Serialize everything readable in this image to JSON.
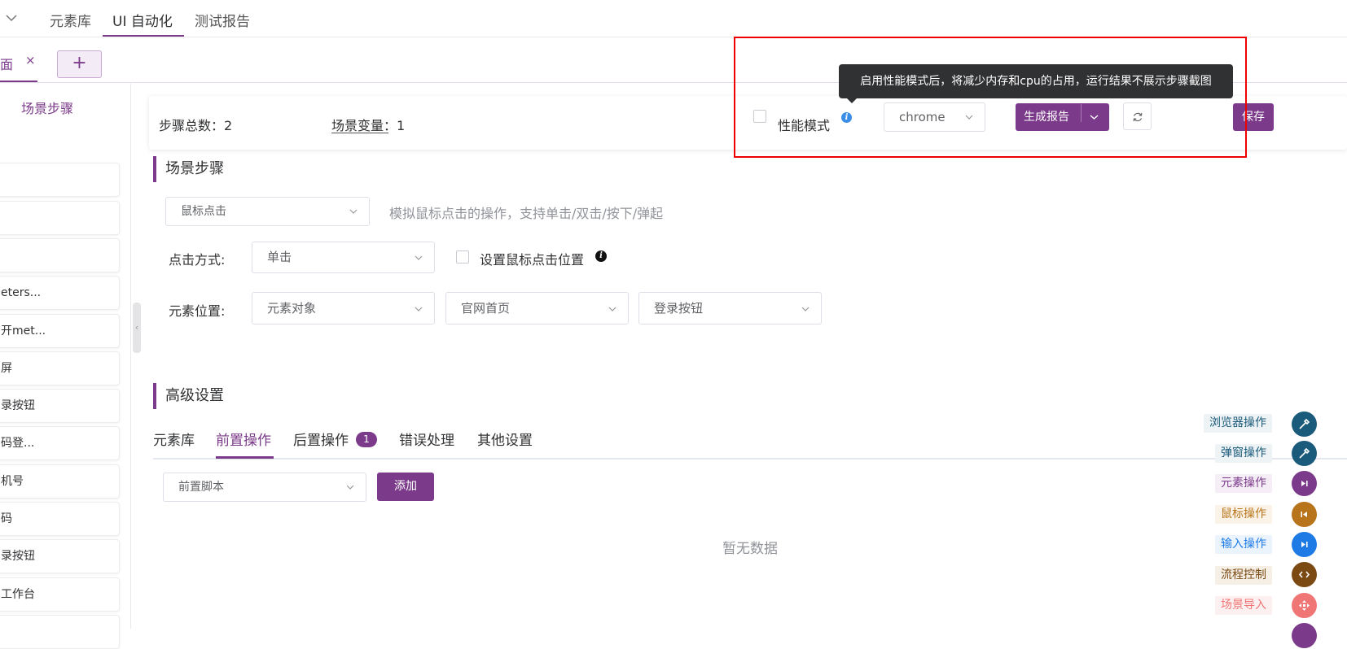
{
  "nav": {
    "items": [
      "元素库",
      "UI 自动化",
      "测试报告"
    ]
  },
  "tab": {
    "label_fragment": "面",
    "close": "×",
    "add": "+"
  },
  "left_panel": {
    "title": "场景步骤",
    "steps": [
      "",
      "",
      "",
      "eters...",
      "开met...",
      "屏",
      "录按钮",
      "码登...",
      "机号",
      "码",
      "录按钮",
      "工作台",
      ""
    ]
  },
  "info_bar": {
    "step_total_label": "步骤总数：2",
    "scene_var_label": "场景变量：",
    "scene_var_count": "1",
    "perf_mode_label": "性能模式",
    "info_glyph": "i",
    "browser_value": "chrome",
    "report_btn": "生成报告",
    "save_btn": "保存",
    "tooltip": "启用性能模式后，将减少内存和cpu的占用，运行结果不展示步骤截图"
  },
  "scene_steps": {
    "title": "场景步骤",
    "action_select": "鼠标点击",
    "action_desc": "模拟鼠标点击的操作，支持单击/双击/按下/弹起",
    "click_type_label": "点击方式:",
    "click_type_value": "单击",
    "set_pos_label": "设置鼠标点击位置",
    "element_pos_label": "元素位置:",
    "element_type_value": "元素对象",
    "page_value": "官网首页",
    "element_value": "登录按钮"
  },
  "advanced": {
    "title": "高级设置",
    "tabs": [
      "元素库",
      "前置操作",
      "后置操作",
      "错误处理",
      "其他设置"
    ],
    "post_badge": "1",
    "script_select": "前置脚本",
    "add_btn": "添加",
    "empty_text": "暂无数据"
  },
  "float_menu": [
    {
      "label": "浏览器操作",
      "color": "#1a5a7a",
      "bg": "#eef3f6"
    },
    {
      "label": "弹窗操作",
      "color": "#1a5a7a",
      "bg": "#eef3f6"
    },
    {
      "label": "元素操作",
      "color": "#7b3a8a",
      "bg": "#f5eef7"
    },
    {
      "label": "鼠标操作",
      "color": "#b8741a",
      "bg": "#fbf3e8"
    },
    {
      "label": "输入操作",
      "color": "#1e7be6",
      "bg": "#ebf3fd"
    },
    {
      "label": "流程控制",
      "color": "#7a4a12",
      "bg": "#f6efe6"
    },
    {
      "label": "场景导入",
      "color": "#f07575",
      "bg": "#fdf0f0"
    }
  ],
  "colors": {
    "accent": "#7b3a8a",
    "highlight_box": "#ee0000"
  }
}
